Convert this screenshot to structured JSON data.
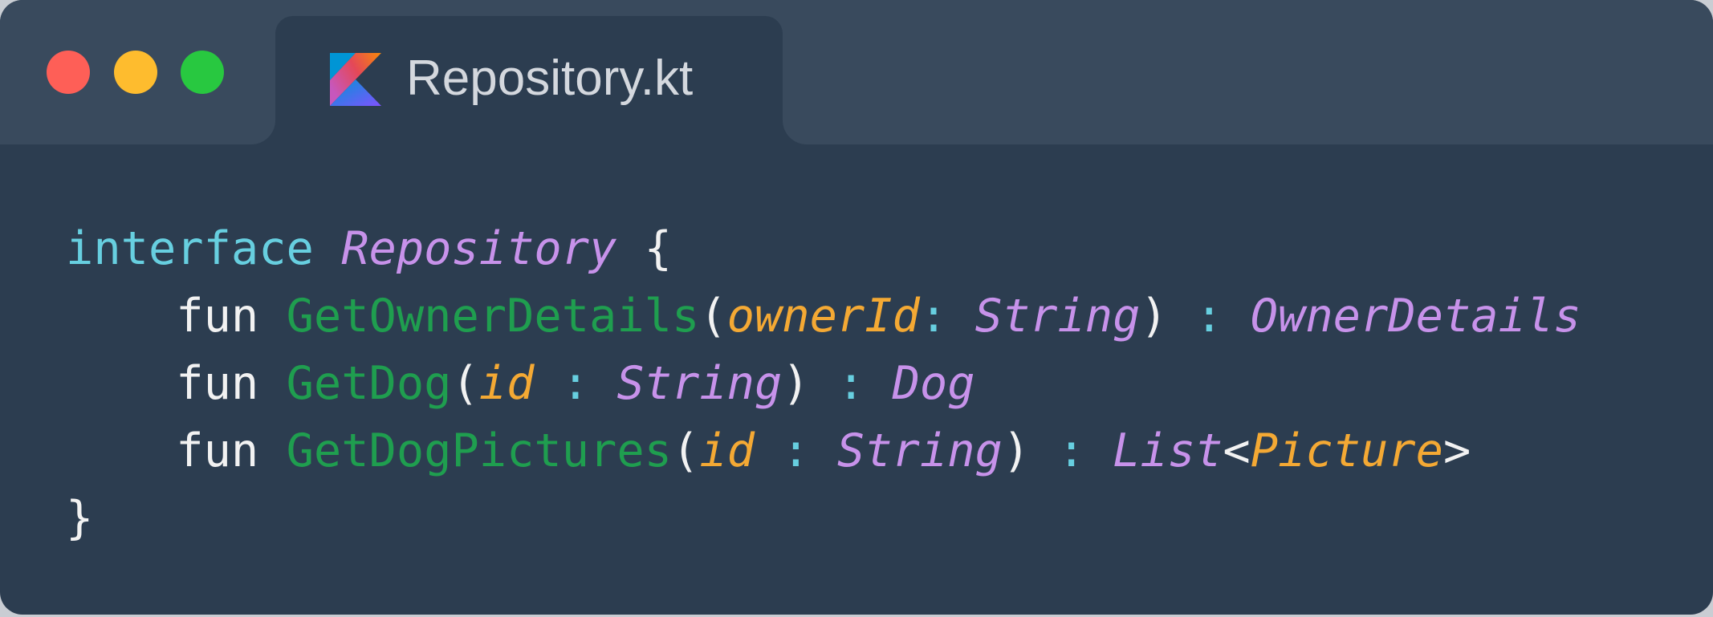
{
  "window": {
    "controls": {
      "close_color": "#fe5f57",
      "minimize_color": "#febc2e",
      "maximize_color": "#28c840"
    }
  },
  "tab": {
    "icon": "kotlin-icon",
    "title": "Repository.kt"
  },
  "code": {
    "lines": [
      {
        "indent": "",
        "tokens": [
          {
            "text": "interface",
            "kind": "kw"
          },
          {
            "text": " ",
            "kind": "plain"
          },
          {
            "text": "Repository",
            "kind": "type"
          },
          {
            "text": " {",
            "kind": "punc"
          }
        ]
      },
      {
        "indent": "    ",
        "tokens": [
          {
            "text": "fun",
            "kind": "plain"
          },
          {
            "text": " ",
            "kind": "plain"
          },
          {
            "text": "GetOwnerDetails",
            "kind": "fn"
          },
          {
            "text": "(",
            "kind": "punc"
          },
          {
            "text": "ownerId",
            "kind": "param"
          },
          {
            "text": ": ",
            "kind": "colon"
          },
          {
            "text": "String",
            "kind": "type"
          },
          {
            "text": ")",
            "kind": "punc"
          },
          {
            "text": " : ",
            "kind": "colon"
          },
          {
            "text": "OwnerDetails",
            "kind": "type"
          }
        ]
      },
      {
        "indent": "    ",
        "tokens": [
          {
            "text": "fun",
            "kind": "plain"
          },
          {
            "text": " ",
            "kind": "plain"
          },
          {
            "text": "GetDog",
            "kind": "fn"
          },
          {
            "text": "(",
            "kind": "punc"
          },
          {
            "text": "id",
            "kind": "param"
          },
          {
            "text": " : ",
            "kind": "colon"
          },
          {
            "text": "String",
            "kind": "type"
          },
          {
            "text": ")",
            "kind": "punc"
          },
          {
            "text": " : ",
            "kind": "colon"
          },
          {
            "text": "Dog",
            "kind": "type"
          }
        ]
      },
      {
        "indent": "    ",
        "tokens": [
          {
            "text": "fun",
            "kind": "plain"
          },
          {
            "text": " ",
            "kind": "plain"
          },
          {
            "text": "GetDogPictures",
            "kind": "fn"
          },
          {
            "text": "(",
            "kind": "punc"
          },
          {
            "text": "id",
            "kind": "param"
          },
          {
            "text": " : ",
            "kind": "colon"
          },
          {
            "text": "String",
            "kind": "type"
          },
          {
            "text": ")",
            "kind": "punc"
          },
          {
            "text": " : ",
            "kind": "colon"
          },
          {
            "text": "List",
            "kind": "type"
          },
          {
            "text": "<",
            "kind": "punc"
          },
          {
            "text": "Picture",
            "kind": "param"
          },
          {
            "text": ">",
            "kind": "punc"
          }
        ]
      },
      {
        "indent": "",
        "tokens": [
          {
            "text": "}",
            "kind": "punc"
          }
        ]
      }
    ]
  }
}
